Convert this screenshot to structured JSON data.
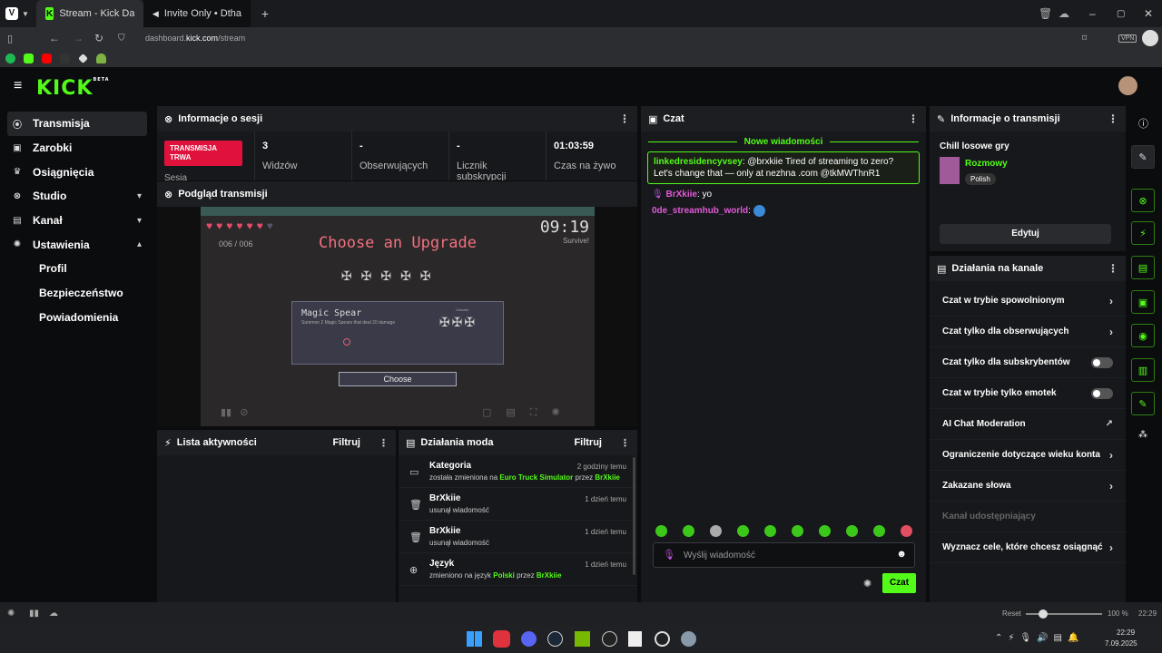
{
  "browser": {
    "tabs": [
      {
        "label": "Stream - Kick Dashboard",
        "active": true
      },
      {
        "label": "Invite Only • Dthang",
        "active": false
      }
    ],
    "url_prefix": "dashboard.",
    "url_domain": "kick.com",
    "url_path": "/stream",
    "vpn": "VPN"
  },
  "logo": {
    "text": "KICK",
    "badge": "BETA"
  },
  "sidebar": {
    "items": [
      {
        "label": "Transmisja",
        "icon": "broadcast-icon"
      },
      {
        "label": "Zarobki",
        "icon": "earnings-icon"
      },
      {
        "label": "Osiągnięcia",
        "icon": "trophy-icon"
      },
      {
        "label": "Studio",
        "icon": "studio-icon"
      },
      {
        "label": "Kanał",
        "icon": "channel-icon"
      },
      {
        "label": "Ustawienia",
        "icon": "gear-icon"
      }
    ],
    "subitems": [
      "Profil",
      "Bezpieczeństwo",
      "Powiadomienia"
    ]
  },
  "session": {
    "title": "Informacje o sesji",
    "live_label": "TRANSMISJA TRWA",
    "live_sub": "Sesja",
    "stats": [
      {
        "value": "3",
        "label": "Widzów"
      },
      {
        "value": "-",
        "label": "Obserwujących"
      },
      {
        "value": "-",
        "label": "Licznik subskrypcji"
      },
      {
        "value": "01:03:59",
        "label": "Czas na żywo"
      }
    ]
  },
  "preview": {
    "title": "Podgląd transmisji",
    "game_title": "Choose an Upgrade",
    "timer": "09:19",
    "survive": "Survive!",
    "counter": "006 / 006",
    "upgrade_name": "Magic Spear",
    "upgrade_desc": "Summon 2 Magic Spears that deal 20 damage",
    "unlocks": "Unlocks",
    "choose": "Choose"
  },
  "activity": {
    "title": "Lista aktywności",
    "filter": "Filtruj"
  },
  "mod": {
    "title": "Działania moda",
    "filter": "Filtruj",
    "rows": [
      {
        "title": "Kategoria",
        "time": "2 godziny temu",
        "d1": "została zmieniona na ",
        "h1": "Euro Truck Simulator",
        "d2": " przez ",
        "h2": "BrXkiie"
      },
      {
        "title": "BrXkiie",
        "time": "1 dzień temu",
        "d1": "usunął wiadomość",
        "h1": "",
        "d2": "",
        "h2": ""
      },
      {
        "title": "BrXkiie",
        "time": "1 dzień temu",
        "d1": "usunął wiadomość",
        "h1": "",
        "d2": "",
        "h2": ""
      },
      {
        "title": "Język",
        "time": "1 dzień temu",
        "d1": "zmieniono na język ",
        "h1": "Polski",
        "d2": " przez ",
        "h2": "BrXkiie"
      }
    ]
  },
  "chat": {
    "title": "Czat",
    "new_messages": "Nowe wiadomości",
    "messages": [
      {
        "user": "linkedresidencyvsey",
        "text": ": @brxkiie Tired of streaming to zero? Let's change that — only at nezhna .com @tkMWThnR1",
        "color": "#53fc18"
      },
      {
        "user": "BrXkiie",
        "text": ": yo",
        "color": "#e05ad8"
      },
      {
        "user": "0de_streamhub_world",
        "text": ":",
        "color": "#e05ad8"
      }
    ],
    "placeholder": "Wyślij wiadomość",
    "send": "Czat"
  },
  "stream_info": {
    "title": "Informacje o transmisji",
    "stream_title": "Chill losowe gry",
    "category": "Rozmowy",
    "language": "Polish",
    "edit": "Edytuj"
  },
  "channel_actions": {
    "title": "Działania na kanale",
    "items": [
      {
        "label": "Czat w trybie spowolnionym",
        "control": "arrow"
      },
      {
        "label": "Czat tylko dla obserwujących",
        "control": "arrow"
      },
      {
        "label": "Czat tylko dla subskrybentów",
        "control": "toggle"
      },
      {
        "label": "Czat w trybie tylko emotek",
        "control": "toggle"
      },
      {
        "label": "AI Chat Moderation",
        "control": "external"
      },
      {
        "label": "Ograniczenie dotyczące wieku konta",
        "control": "arrow"
      },
      {
        "label": "Zakazane słowa",
        "control": "arrow"
      },
      {
        "label": "Kanał udostępniający",
        "control": "none"
      },
      {
        "label": "Wyznacz cele, które chcesz osiągnąć",
        "control": "arrow"
      }
    ]
  },
  "status": {
    "reset": "Reset",
    "zoom": "100 %",
    "clock": "22:29"
  },
  "taskbar": {
    "time": "22:29",
    "date": "7.09.2025"
  },
  "colors": {
    "accent": "#53fc18",
    "live": "#e0123c",
    "panel": "#17181b"
  }
}
